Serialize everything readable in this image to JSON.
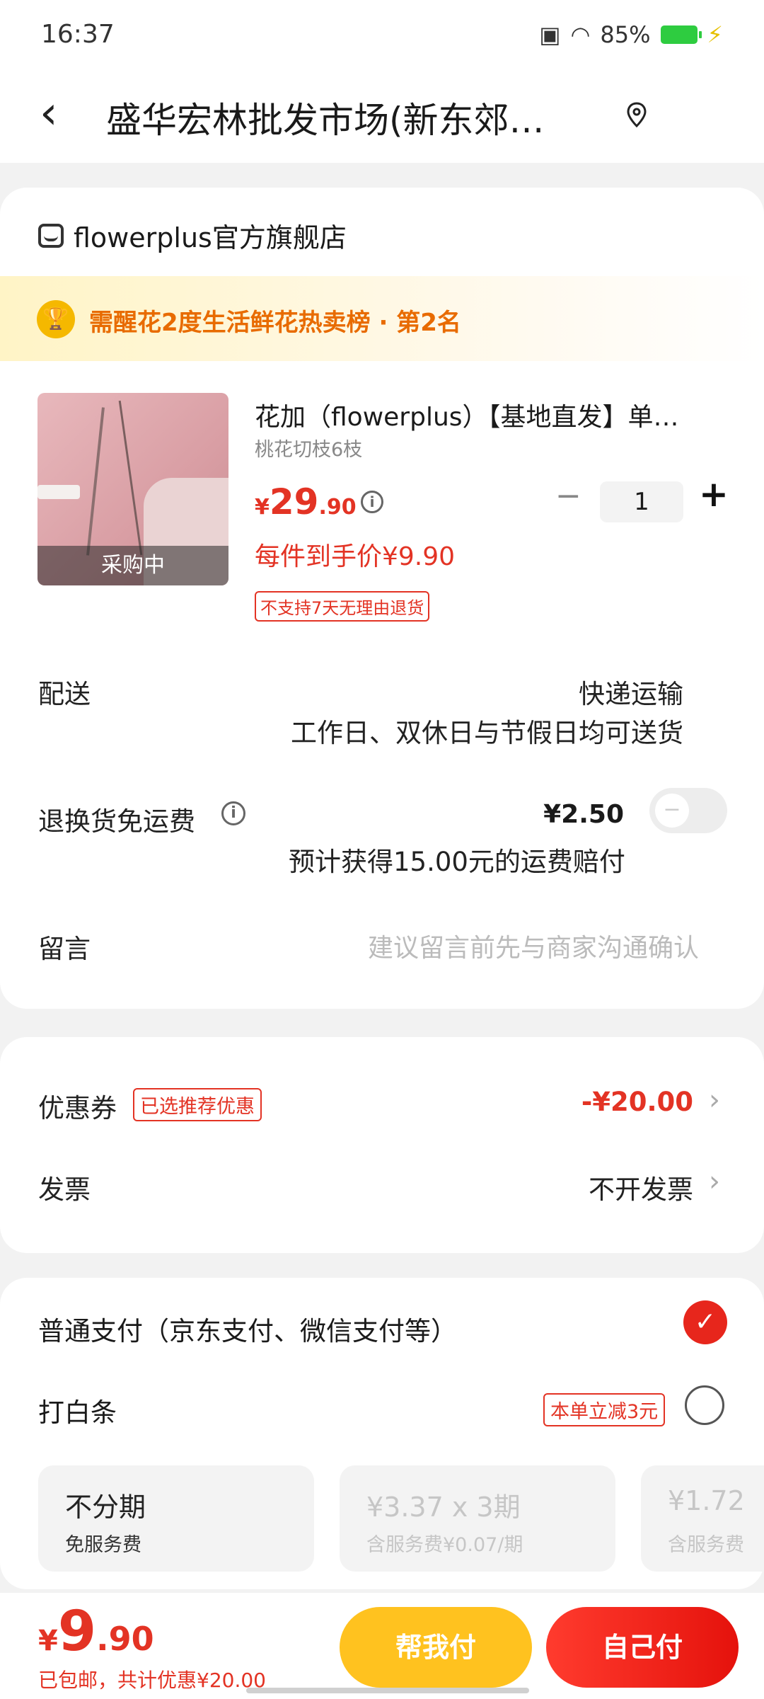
{
  "status": {
    "time": "16:37",
    "battery": "85%"
  },
  "header": {
    "title": "盛华宏林批发市场(新东郊…"
  },
  "store": {
    "name": "flowerplus官方旗舰店"
  },
  "rank": {
    "text": "需醒花2度生活鲜花热卖榜 · 第2名"
  },
  "product": {
    "name": "花加（flowerplus）【基地直发】单…",
    "spec": "桃花切枝6枝",
    "badge": "采购中",
    "price_symbol": "¥",
    "price_int": "29",
    "price_dec": ".90",
    "quantity": "1",
    "minus": "−",
    "plus": "+",
    "each_price": "每件到手价¥9.90",
    "no_return": "不支持7天无理由退货"
  },
  "shipping": {
    "label": "配送",
    "method": "快递运输",
    "note": "工作日、双休日与节假日均可送货"
  },
  "return_fee": {
    "label": "退换货免运费",
    "price": "¥2.50",
    "note": "预计获得15.00元的运费赔付",
    "enabled": false
  },
  "message": {
    "label": "留言",
    "placeholder": "建议留言前先与商家沟通确认"
  },
  "coupon": {
    "label": "优惠券",
    "tag": "已选推荐优惠",
    "value": "-¥20.00"
  },
  "invoice": {
    "label": "发票",
    "value": "不开发票"
  },
  "payment": {
    "normal": "普通支付（京东支付、微信支付等）",
    "baitiao": "打白条",
    "baitiao_tag": "本单立减3元",
    "installments": [
      {
        "title": "不分期",
        "sub": "免服务费"
      },
      {
        "title": "¥3.37 x 3期",
        "sub": "含服务费¥0.07/期"
      },
      {
        "title": "¥1.72",
        "sub": "含服务费"
      }
    ]
  },
  "footer": {
    "total_symbol": "¥",
    "total_int": "9",
    "total_dec": ".90",
    "summary": "已包邮，共计优惠¥20.00",
    "help_pay": "帮我付",
    "self_pay": "自己付"
  },
  "colors": {
    "accent": "#e33324",
    "help": "#ffc21f"
  }
}
